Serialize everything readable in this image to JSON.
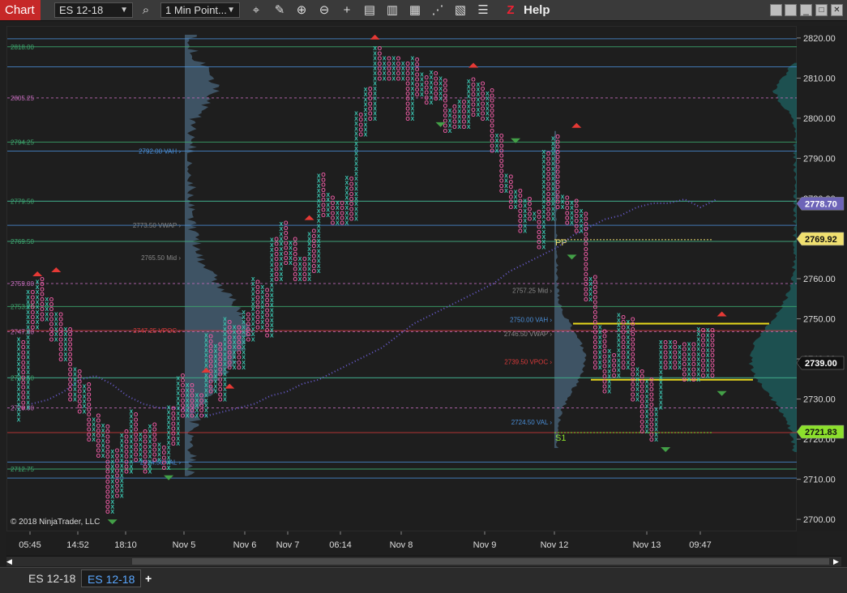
{
  "toolbar": {
    "title": "Chart",
    "instrument": "ES 12-18",
    "period": "1 Min Point...",
    "help": "Help",
    "tools": [
      {
        "icon": "crosshair-x-icon",
        "glyph": "⌖"
      },
      {
        "icon": "pencil-icon",
        "glyph": "✎"
      },
      {
        "icon": "zoom-in-icon",
        "glyph": "⊕"
      },
      {
        "icon": "zoom-out-icon",
        "glyph": "⊖"
      },
      {
        "icon": "crosshair-icon",
        "glyph": "+"
      },
      {
        "icon": "data-box-icon",
        "glyph": "▤"
      },
      {
        "icon": "properties-icon",
        "glyph": "▥"
      },
      {
        "icon": "chart-style-icon",
        "glyph": "▦"
      },
      {
        "icon": "indicators-icon",
        "glyph": "⋰"
      },
      {
        "icon": "strategies-icon",
        "glyph": "▧"
      },
      {
        "icon": "templates-icon",
        "glyph": "☰"
      },
      {
        "icon": "z-logo-icon",
        "glyph": "Z"
      }
    ],
    "window_buttons": [
      "▫",
      "▪",
      "□",
      "✕"
    ]
  },
  "copyright": "© 2018 NinjaTrader, LLC",
  "tabs": [
    {
      "label": "ES 12-18",
      "active": false
    },
    {
      "label": "ES 12-18",
      "active": true
    }
  ],
  "add_tab": "+",
  "colors": {
    "up_x": "#3cc8b4",
    "down_o": "#e65aa0",
    "hline_blue": "#4a8fd9",
    "hline_green": "#3da86e",
    "hline_pink": "#c06ab8",
    "poc_red": "#d93a3a",
    "vwap_dots": "#6a5cd0",
    "yellow": "#e8d81c",
    "badge_purple": "#6d64b8",
    "badge_yellow": "#f0e070",
    "badge_green": "#8ce02c"
  },
  "chart_data": {
    "type": "point_and_figure",
    "ylim": [
      2697,
      2823
    ],
    "y_ticks": [
      "2820.00",
      "2810.00",
      "2800.00",
      "2790.00",
      "2780.00",
      "2770.00",
      "2760.00",
      "2750.00",
      "2740.00",
      "2730.00",
      "2720.00",
      "2710.00",
      "2700.00"
    ],
    "x_ticks": [
      "05:45",
      "14:52",
      "18:10",
      "Nov 5",
      "Nov 6",
      "Nov 7",
      "06:14",
      "Nov 8",
      "Nov 9",
      "Nov 12",
      "Nov 13",
      "09:47"
    ],
    "price_badges": [
      {
        "label": "2778.70",
        "price": 2778.7,
        "style": "purple"
      },
      {
        "label": "2769.92",
        "price": 2769.92,
        "style": "yellow"
      },
      {
        "label": "2739.00",
        "price": 2739.0,
        "style": "dark"
      },
      {
        "label": "2721.83",
        "price": 2721.83,
        "style": "green"
      }
    ],
    "left_levels": [
      {
        "label": "2818.00",
        "price": 2818.0,
        "color": "green"
      },
      {
        "label": "2805.25",
        "price": 2805.25,
        "color": "pink"
      },
      {
        "label": "2794.25",
        "price": 2794.25,
        "color": "green"
      },
      {
        "label": "2779.50",
        "price": 2779.5,
        "color": "green"
      },
      {
        "label": "2769.50",
        "price": 2769.5,
        "color": "green"
      },
      {
        "label": "2759.00",
        "price": 2759.0,
        "color": "pink"
      },
      {
        "label": "2753.25",
        "price": 2753.25,
        "color": "green"
      },
      {
        "label": "2747.00",
        "price": 2747.0,
        "color": "pink"
      },
      {
        "label": "2735.50",
        "price": 2735.5,
        "color": "green"
      },
      {
        "label": "2728.00",
        "price": 2728.0,
        "color": "pink"
      },
      {
        "label": "2712.75",
        "price": 2712.75,
        "color": "green"
      }
    ],
    "profile_labels": [
      {
        "label": "2792.00 VAH",
        "price": 2792.0,
        "color": "blue",
        "side": "left"
      },
      {
        "label": "2773.50 VWAP",
        "price": 2773.5,
        "color": "grey",
        "side": "left"
      },
      {
        "label": "2765.50 Mid",
        "price": 2765.5,
        "color": "grey",
        "side": "left"
      },
      {
        "label": "2747.25 VPOC",
        "price": 2747.25,
        "color": "red",
        "side": "left"
      },
      {
        "label": "2714.50 VAL",
        "price": 2714.5,
        "color": "blue",
        "side": "left"
      },
      {
        "label": "2757.25 Mid",
        "price": 2757.25,
        "color": "grey",
        "side": "right"
      },
      {
        "label": "2750.00 VAH",
        "price": 2750.0,
        "color": "blue",
        "side": "right"
      },
      {
        "label": "2746.50 VWAP",
        "price": 2746.5,
        "color": "grey",
        "side": "right"
      },
      {
        "label": "2739.50 VPOC",
        "price": 2739.5,
        "color": "red",
        "side": "right"
      },
      {
        "label": "2724.50 VAL",
        "price": 2724.5,
        "color": "blue",
        "side": "right"
      }
    ],
    "pivot_labels": [
      {
        "label": "PP",
        "price": 2769.92
      },
      {
        "label": "S1",
        "price": 2721.83
      }
    ],
    "pnf_columns": [
      [
        2725,
        2745
      ],
      [
        2745,
        2728
      ],
      [
        2728,
        2757
      ],
      [
        2757,
        2748
      ],
      [
        2748,
        2760
      ],
      [
        2760,
        2750
      ],
      [
        2750,
        2755
      ],
      [
        2755,
        2745
      ],
      [
        2745,
        2752
      ],
      [
        2752,
        2740
      ],
      [
        2740,
        2748
      ],
      [
        2748,
        2730
      ],
      [
        2730,
        2738
      ],
      [
        2738,
        2727
      ],
      [
        2727,
        2734
      ],
      [
        2734,
        2720
      ],
      [
        2720,
        2726
      ],
      [
        2726,
        2716
      ],
      [
        2716,
        2724
      ],
      [
        2724,
        2702
      ],
      [
        2702,
        2718
      ],
      [
        2718,
        2706
      ],
      [
        2706,
        2722
      ],
      [
        2722,
        2712
      ],
      [
        2712,
        2727
      ],
      [
        2727,
        2715
      ],
      [
        2715,
        2722
      ],
      [
        2722,
        2712
      ],
      [
        2712,
        2724
      ],
      [
        2724,
        2715
      ],
      [
        2715,
        2719
      ],
      [
        2719,
        2713
      ],
      [
        2713,
        2728
      ],
      [
        2728,
        2719
      ],
      [
        2719,
        2736
      ],
      [
        2736,
        2726
      ],
      [
        2726,
        2734
      ],
      [
        2734,
        2726
      ],
      [
        2726,
        2732
      ],
      [
        2732,
        2726
      ],
      [
        2726,
        2746
      ],
      [
        2746,
        2732
      ],
      [
        2732,
        2744
      ],
      [
        2744,
        2730
      ],
      [
        2730,
        2750
      ],
      [
        2750,
        2738
      ],
      [
        2738,
        2748
      ],
      [
        2748,
        2738
      ],
      [
        2738,
        2752
      ],
      [
        2752,
        2745
      ],
      [
        2745,
        2760
      ],
      [
        2760,
        2748
      ],
      [
        2748,
        2758
      ],
      [
        2758,
        2746
      ],
      [
        2746,
        2770
      ],
      [
        2770,
        2760
      ],
      [
        2760,
        2774
      ],
      [
        2774,
        2764
      ],
      [
        2764,
        2770
      ],
      [
        2770,
        2760
      ],
      [
        2760,
        2766
      ],
      [
        2766,
        2760
      ],
      [
        2760,
        2772
      ],
      [
        2772,
        2762
      ],
      [
        2762,
        2786
      ],
      [
        2786,
        2776
      ],
      [
        2776,
        2781
      ],
      [
        2781,
        2774
      ],
      [
        2774,
        2780
      ],
      [
        2780,
        2774
      ],
      [
        2774,
        2786
      ],
      [
        2786,
        2775
      ],
      [
        2775,
        2802
      ],
      [
        2802,
        2796
      ],
      [
        2796,
        2808
      ],
      [
        2808,
        2800
      ],
      [
        2800,
        2818
      ],
      [
        2818,
        2810
      ],
      [
        2810,
        2815
      ],
      [
        2815,
        2810
      ],
      [
        2810,
        2816
      ],
      [
        2816,
        2810
      ],
      [
        2810,
        2814
      ],
      [
        2814,
        2800
      ],
      [
        2800,
        2815
      ],
      [
        2815,
        2806
      ],
      [
        2806,
        2811
      ],
      [
        2811,
        2804
      ],
      [
        2804,
        2812
      ],
      [
        2812,
        2805
      ],
      [
        2805,
        2810
      ],
      [
        2810,
        2797
      ],
      [
        2797,
        2803
      ],
      [
        2803,
        2798
      ],
      [
        2798,
        2805
      ],
      [
        2805,
        2798
      ],
      [
        2798,
        2810
      ],
      [
        2810,
        2801
      ],
      [
        2801,
        2809
      ],
      [
        2809,
        2800
      ],
      [
        2800,
        2807
      ],
      [
        2807,
        2792
      ],
      [
        2792,
        2796
      ],
      [
        2796,
        2782
      ],
      [
        2782,
        2786
      ],
      [
        2786,
        2778
      ],
      [
        2778,
        2782
      ],
      [
        2782,
        2772
      ],
      [
        2772,
        2780
      ],
      [
        2780,
        2775
      ],
      [
        2775,
        2777
      ],
      [
        2777,
        2768
      ],
      [
        2768,
        2792
      ],
      [
        2792,
        2775
      ],
      [
        2775,
        2796
      ],
      [
        2796,
        2778
      ],
      [
        2778,
        2781
      ],
      [
        2781,
        2774
      ],
      [
        2774,
        2780
      ],
      [
        2780,
        2772
      ],
      [
        2772,
        2777
      ],
      [
        2777,
        2755
      ],
      [
        2755,
        2761
      ],
      [
        2761,
        2738
      ],
      [
        2738,
        2748
      ],
      [
        2748,
        2732
      ],
      [
        2732,
        2742
      ],
      [
        2742,
        2736
      ],
      [
        2736,
        2751
      ],
      [
        2751,
        2738
      ],
      [
        2738,
        2750
      ],
      [
        2750,
        2730
      ],
      [
        2730,
        2738
      ],
      [
        2738,
        2722
      ],
      [
        2722,
        2735
      ],
      [
        2735,
        2720
      ],
      [
        2720,
        2728
      ],
      [
        2728,
        2745
      ],
      [
        2745,
        2738
      ],
      [
        2738,
        2745
      ],
      [
        2745,
        2738
      ],
      [
        2738,
        2744
      ],
      [
        2744,
        2735
      ],
      [
        2735,
        2744
      ],
      [
        2744,
        2735
      ],
      [
        2735,
        2748
      ],
      [
        2748,
        2736
      ],
      [
        2736,
        2748
      ],
      [
        2748,
        2736
      ]
    ],
    "vwap_path": [
      [
        0,
        2729
      ],
      [
        12,
        2730
      ],
      [
        24,
        2732
      ],
      [
        36,
        2735
      ],
      [
        48,
        2736
      ],
      [
        60,
        2734
      ],
      [
        72,
        2731
      ],
      [
        84,
        2729
      ],
      [
        96,
        2728
      ],
      [
        108,
        2728
      ],
      [
        120,
        2727
      ],
      [
        132,
        2726
      ],
      [
        144,
        2727
      ],
      [
        156,
        2728
      ],
      [
        168,
        2729
      ],
      [
        180,
        2731
      ],
      [
        192,
        2732
      ],
      [
        204,
        2734
      ],
      [
        216,
        2735
      ],
      [
        228,
        2737
      ],
      [
        240,
        2739
      ],
      [
        252,
        2741
      ],
      [
        264,
        2743
      ],
      [
        276,
        2746
      ],
      [
        288,
        2749
      ],
      [
        300,
        2751
      ],
      [
        312,
        2753
      ],
      [
        324,
        2755
      ],
      [
        336,
        2757
      ],
      [
        348,
        2759
      ],
      [
        360,
        2762
      ],
      [
        372,
        2764
      ],
      [
        384,
        2766
      ],
      [
        396,
        2768
      ],
      [
        408,
        2771
      ],
      [
        420,
        2773
      ],
      [
        432,
        2775
      ],
      [
        444,
        2776
      ],
      [
        456,
        2778
      ],
      [
        468,
        2779
      ],
      [
        480,
        2779
      ],
      [
        492,
        2780
      ],
      [
        504,
        2778
      ],
      [
        516,
        2780
      ]
    ],
    "grid": false,
    "legend": "none"
  }
}
